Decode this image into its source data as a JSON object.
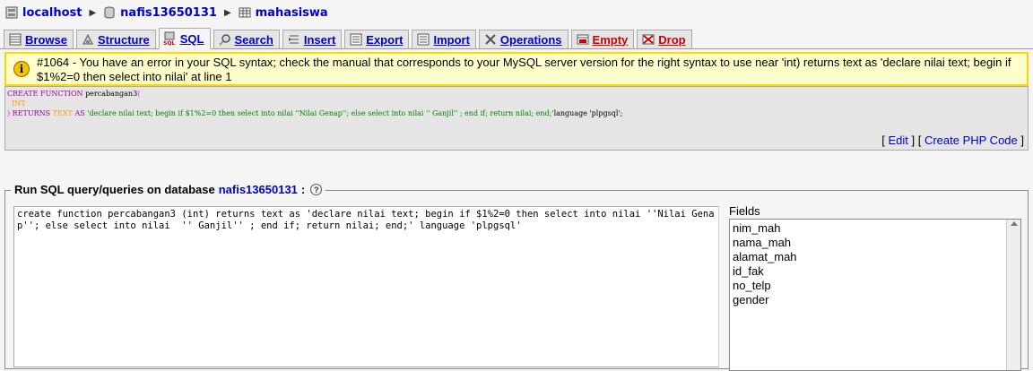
{
  "breadcrumb": {
    "server": "localhost",
    "database": "nafis13650131",
    "table": "mahasiswa"
  },
  "tabs": [
    {
      "label": "Browse",
      "icon": "browse-icon"
    },
    {
      "label": "Structure",
      "icon": "structure-icon"
    },
    {
      "label": "SQL",
      "icon": "sql-icon"
    },
    {
      "label": "Search",
      "icon": "search-icon"
    },
    {
      "label": "Insert",
      "icon": "insert-icon"
    },
    {
      "label": "Export",
      "icon": "export-icon"
    },
    {
      "label": "Import",
      "icon": "import-icon"
    },
    {
      "label": "Operations",
      "icon": "operations-icon"
    },
    {
      "label": "Empty",
      "icon": "empty-icon"
    },
    {
      "label": "Drop",
      "icon": "drop-icon"
    }
  ],
  "error": {
    "message": "#1064 - You have an error in your SQL syntax; check the manual that corresponds to your MySQL server version for the right syntax to use near 'int) returns text as 'declare nilai text; begin if $1%2=0 then select into nilai' at line 1"
  },
  "sql_display": {
    "line1_kw": "CREATE FUNCTION",
    "line1_name": "percabangan3",
    "line1_paren": "(",
    "line2_type": "INT",
    "line3_paren": ")",
    "line3_returns": "RETURNS",
    "line3_type": "TEXT",
    "line3_as": "AS",
    "line3_str": "'declare nilai text; begin if $1%2=0 then select into nilai ''Nilai Genap''; else select into nilai  '' Ganjil'' ; end if; return nilai; end;'",
    "line3_rest": "language 'plpgsql';",
    "edit_link": "Edit",
    "php_link": "Create PHP Code"
  },
  "query_panel": {
    "legend_prefix": "Run SQL query/queries on database",
    "database": "nafis13650131",
    "legend_suffix": ":",
    "query_text": "create function percabangan3 (int) returns text as 'declare nilai text; begin if $1%2=0 then select into nilai ''Nilai Genap''; else select into nilai  '' Ganjil'' ; end if; return nilai; end;' language 'plpgsql'",
    "fields_label": "Fields",
    "fields": [
      "nim_mah",
      "nama_mah",
      "alamat_mah",
      "id_fak",
      "no_telp",
      "gender"
    ]
  }
}
